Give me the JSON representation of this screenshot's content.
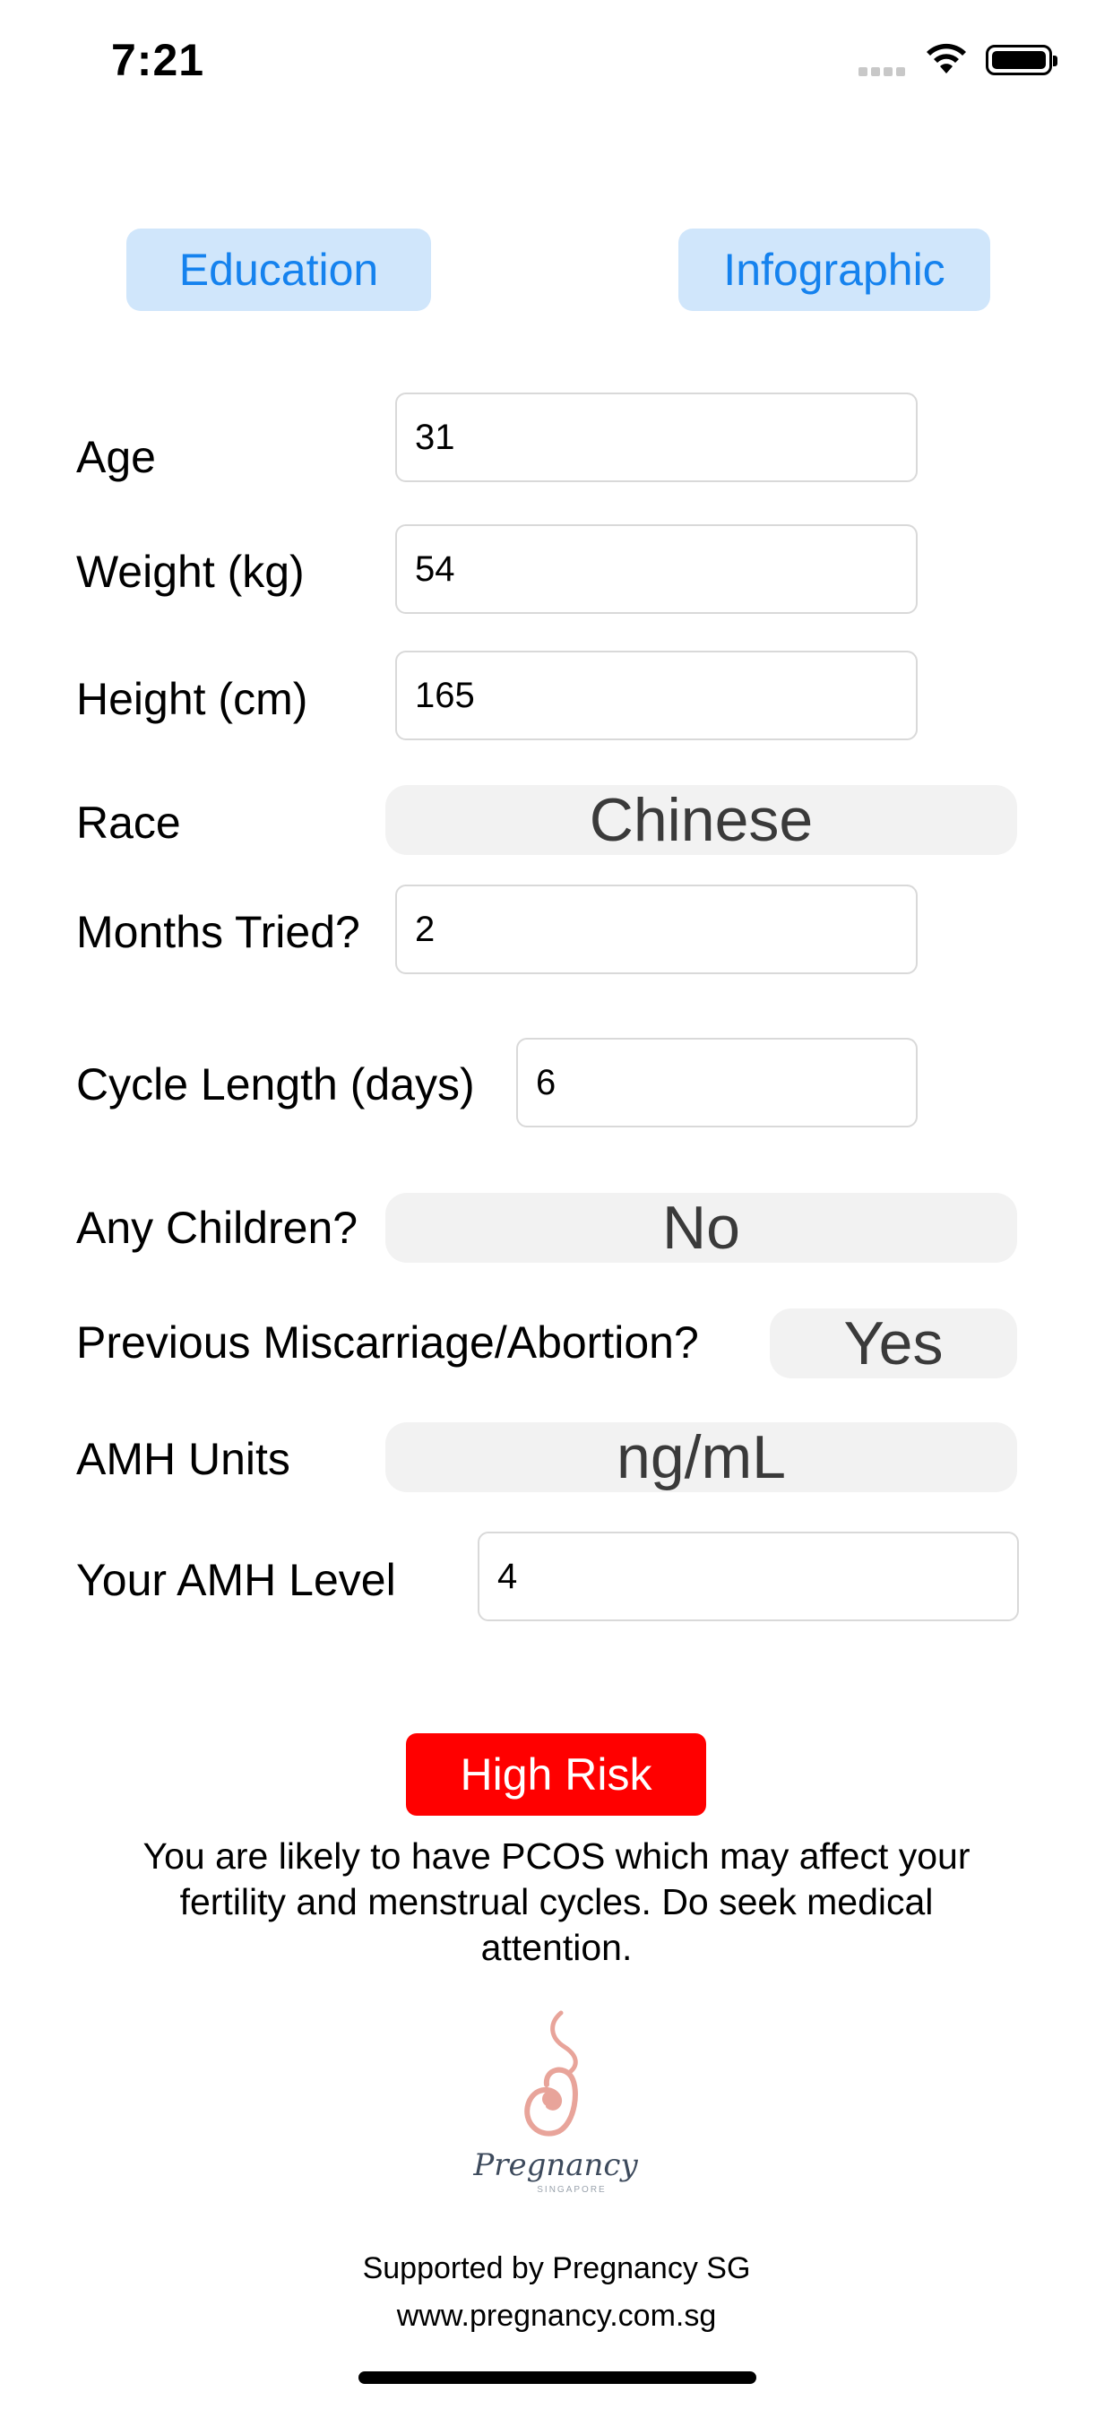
{
  "status_bar": {
    "time": "7:21"
  },
  "top_buttons": {
    "education": "Education",
    "infographic": "Infographic"
  },
  "form": {
    "age": {
      "label": "Age",
      "value": "31"
    },
    "weight": {
      "label": "Weight (kg)",
      "value": "54"
    },
    "height": {
      "label": "Height (cm)",
      "value": "165"
    },
    "race": {
      "label": "Race",
      "value": "Chinese"
    },
    "months_tried": {
      "label": "Months Tried?",
      "value": "2"
    },
    "cycle_length": {
      "label": "Cycle Length (days)",
      "value": "6"
    },
    "any_children": {
      "label": "Any Children?",
      "value": "No"
    },
    "miscarriage": {
      "label": "Previous Miscarriage/Abortion?",
      "value": "Yes"
    },
    "amh_units": {
      "label": "AMH Units",
      "value": "ng/mL"
    },
    "amh_level": {
      "label": "Your AMH Level",
      "value": "4"
    }
  },
  "result": {
    "risk_label": "High Risk",
    "risk_color": "#ff0000",
    "message": "You are likely to have PCOS which may affect your fertility and menstrual cycles. Do seek medical attention."
  },
  "logo": {
    "text": "Pregnancy",
    "subtext": "SINGAPORE",
    "icon": "pregnancy-logo-icon"
  },
  "footer": {
    "supported_by": "Supported by Pregnancy SG",
    "url": "www.pregnancy.com.sg"
  },
  "colors": {
    "accent": "#1582ee",
    "button_bg": "#d0e6fb",
    "picker_bg": "#f2f2f2",
    "logo": "#e8a49a"
  }
}
